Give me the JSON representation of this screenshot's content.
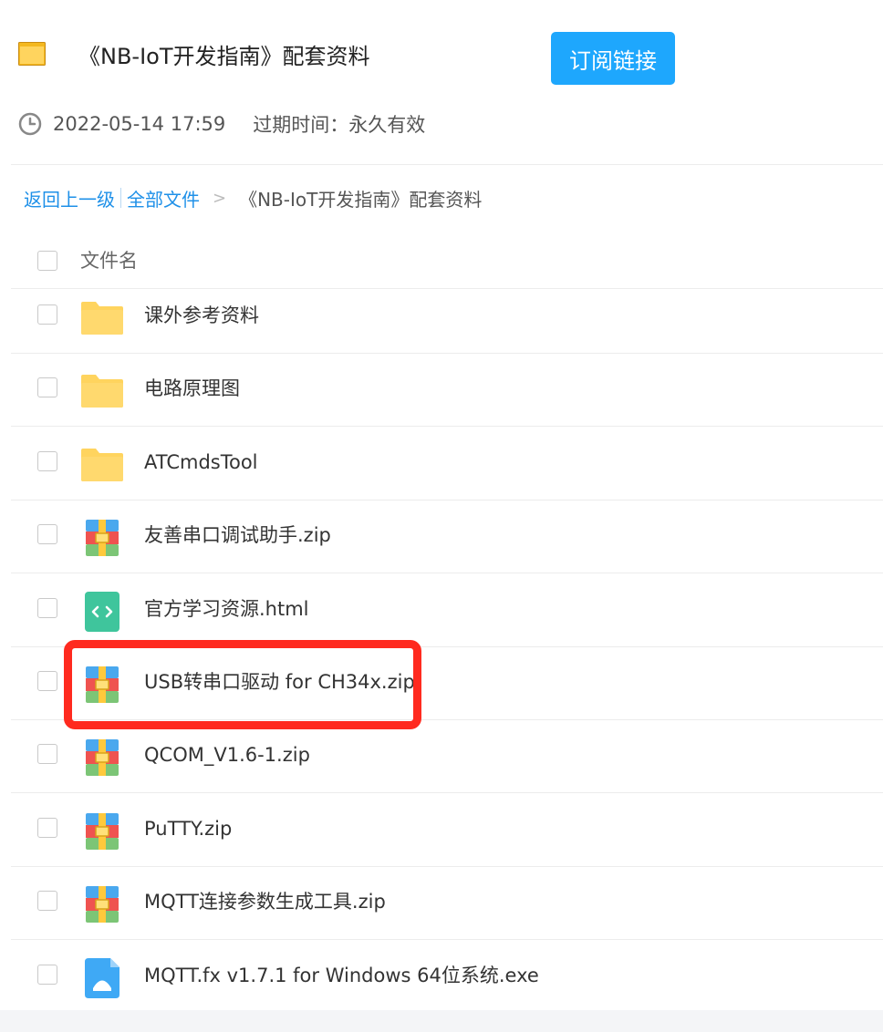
{
  "header": {
    "title": "《NB-IoT开发指南》配套资料",
    "subscribe_label": "订阅链接",
    "date": "2022-05-14 17:59",
    "expire_label": "过期时间：",
    "expire_value": "永久有效"
  },
  "breadcrumb": {
    "back": "返回上一级",
    "root": "全部文件",
    "arrow": ">",
    "current": "《NB-IoT开发指南》配套资料"
  },
  "list": {
    "column_name": "文件名",
    "files": [
      {
        "name": "课外参考资料",
        "icon": "folder-icon"
      },
      {
        "name": "电路原理图",
        "icon": "folder-icon"
      },
      {
        "name": "ATCmdsTool",
        "icon": "folder-icon"
      },
      {
        "name": "友善串口调试助手.zip",
        "icon": "zip-icon"
      },
      {
        "name": "官方学习资源.html",
        "icon": "html-file-icon"
      },
      {
        "name": "USB转串口驱动 for CH34x.zip",
        "icon": "zip-icon"
      },
      {
        "name": "QCOM_V1.6-1.zip",
        "icon": "zip-icon"
      },
      {
        "name": "PuTTY.zip",
        "icon": "zip-icon"
      },
      {
        "name": "MQTT连接参数生成工具.zip",
        "icon": "zip-icon"
      },
      {
        "name": "MQTT.fx v1.7.1 for Windows 64位系统.exe",
        "icon": "exe-file-icon"
      }
    ]
  },
  "colors": {
    "accent": "#1ea7fd",
    "link": "#1e90e8",
    "folder": "#ffd45e",
    "highlight": "#ff2a1f"
  }
}
